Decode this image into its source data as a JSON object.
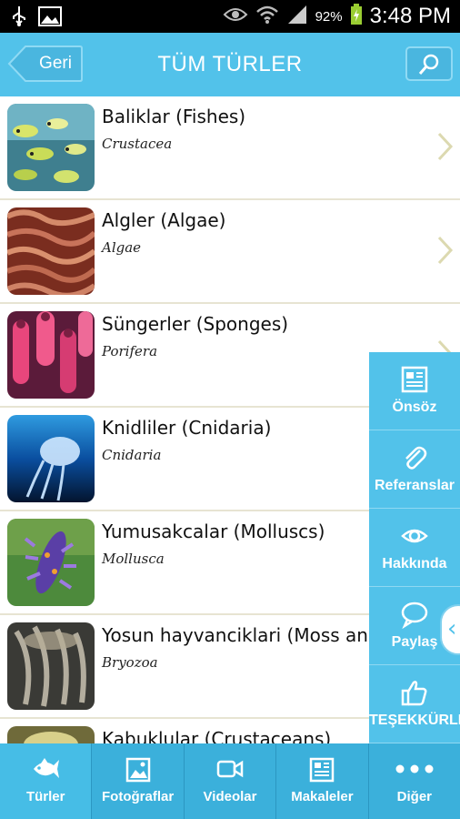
{
  "status_bar": {
    "battery_percent": "92%",
    "time": "3:48 PM",
    "icons": [
      "usb-icon",
      "image-icon",
      "eye-icon",
      "wifi-icon",
      "signal-icon",
      "battery-charging-icon"
    ]
  },
  "header": {
    "back_label": "Geri",
    "title": "TÜM TÜRLER",
    "search_icon": "search-icon"
  },
  "species": [
    {
      "title": "Baliklar (Fishes)",
      "subtitle": "Crustacea"
    },
    {
      "title": "Algler (Algae)",
      "subtitle": "Algae"
    },
    {
      "title": "Süngerler (Sponges)",
      "subtitle": "Porifera"
    },
    {
      "title": "Knidliler (Cnidaria)",
      "subtitle": "Cnidaria"
    },
    {
      "title": "Yumusakcalar (Molluscs)",
      "subtitle": "Mollusca"
    },
    {
      "title": "Yosun hayvanciklari (Moss an",
      "subtitle": "Bryozoa"
    },
    {
      "title": "Kabuklular (Crustaceans)",
      "subtitle": ""
    }
  ],
  "side_menu": {
    "items": [
      {
        "label": "Önsöz",
        "icon": "newspaper-icon"
      },
      {
        "label": "Referanslar",
        "icon": "paperclip-icon"
      },
      {
        "label": "Hakkında",
        "icon": "eye-icon"
      },
      {
        "label": "Paylaş",
        "icon": "speech-bubble-icon"
      },
      {
        "label": "TEŞEKKÜRLER",
        "icon": "thumbs-up-icon"
      }
    ],
    "toggle_icon": "chevron-left-icon"
  },
  "tab_bar": {
    "active": "Türler",
    "tabs": [
      {
        "label": "Türler",
        "icon": "fish-icon"
      },
      {
        "label": "Fotoğraflar",
        "icon": "photo-icon"
      },
      {
        "label": "Videolar",
        "icon": "video-camera-icon"
      },
      {
        "label": "Makaleler",
        "icon": "article-icon"
      },
      {
        "label": "Diğer",
        "icon": "more-dots-icon"
      }
    ]
  },
  "colors": {
    "header": "#52c2ea",
    "tab_bar": "#3bb0db",
    "divider": "#e7e4d2"
  }
}
